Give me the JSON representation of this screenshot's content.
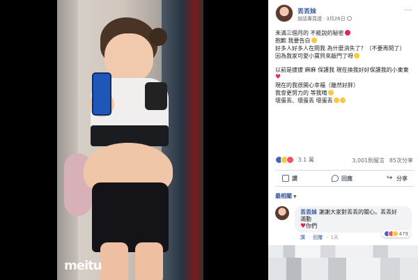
{
  "photo": {
    "watermark": "meitu"
  },
  "post": {
    "author": "丟丟妹",
    "subtitle": "說話專頁證",
    "date": "3月26日",
    "lines": [
      "未滿三個月的 不能說的秘密",
      "抱歉 我要告白",
      "好多人好多人在問我 為什麼消失了？（不要再問了）",
      "因為我家可愛小寶貝來敲門了呀",
      "以前是拔拔 麻麻 保護我 現在換我好好保護我的小東東",
      "現在的我很開心幸福（雖然好胖）",
      "我會更努力的 等我唷",
      "壞蛋丟、壞蛋丟 壞蛋丟"
    ]
  },
  "reactions": {
    "count": "3.1 萬",
    "comments": "3,001則留言",
    "shares": "85次分享"
  },
  "actions": {
    "like": "讚",
    "comment": "回應",
    "share": "分享"
  },
  "sort": {
    "label": "最相關"
  },
  "comment": {
    "author": "丟丟妹",
    "text": "謝謝大家對丟丟的關心。丟丟好",
    "text2": "滿動",
    "text3": "你們",
    "like_label": "讚",
    "reply_label": "回覆",
    "time": "1天",
    "reaction_count": "479"
  },
  "colors": {
    "link": "#385898",
    "like": "#4267b2",
    "love": "#f25268",
    "wow": "#f7c844"
  }
}
